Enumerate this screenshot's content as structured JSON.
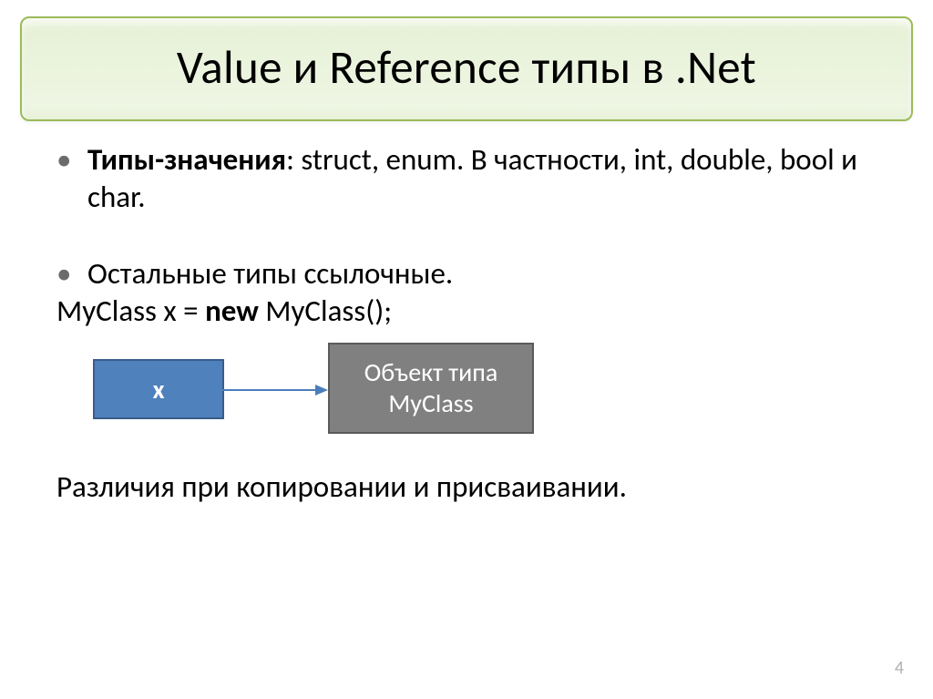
{
  "title": "Value и Reference типы в .Net",
  "bullet1_strong": "Типы-значения",
  "bullet1_rest": ": struct, enum. В частности, int, double, bool и char.",
  "bullet2": "Остальные типы ссылочные.",
  "code_pre": "MyClass x = ",
  "code_new": "new",
  "code_post": " MyClass();",
  "diagram": {
    "x_label": "x",
    "obj_line1": "Объект типа",
    "obj_line2": "MyClass"
  },
  "conclusion": "Различия при копировании и присваивании.",
  "page_number": "4"
}
